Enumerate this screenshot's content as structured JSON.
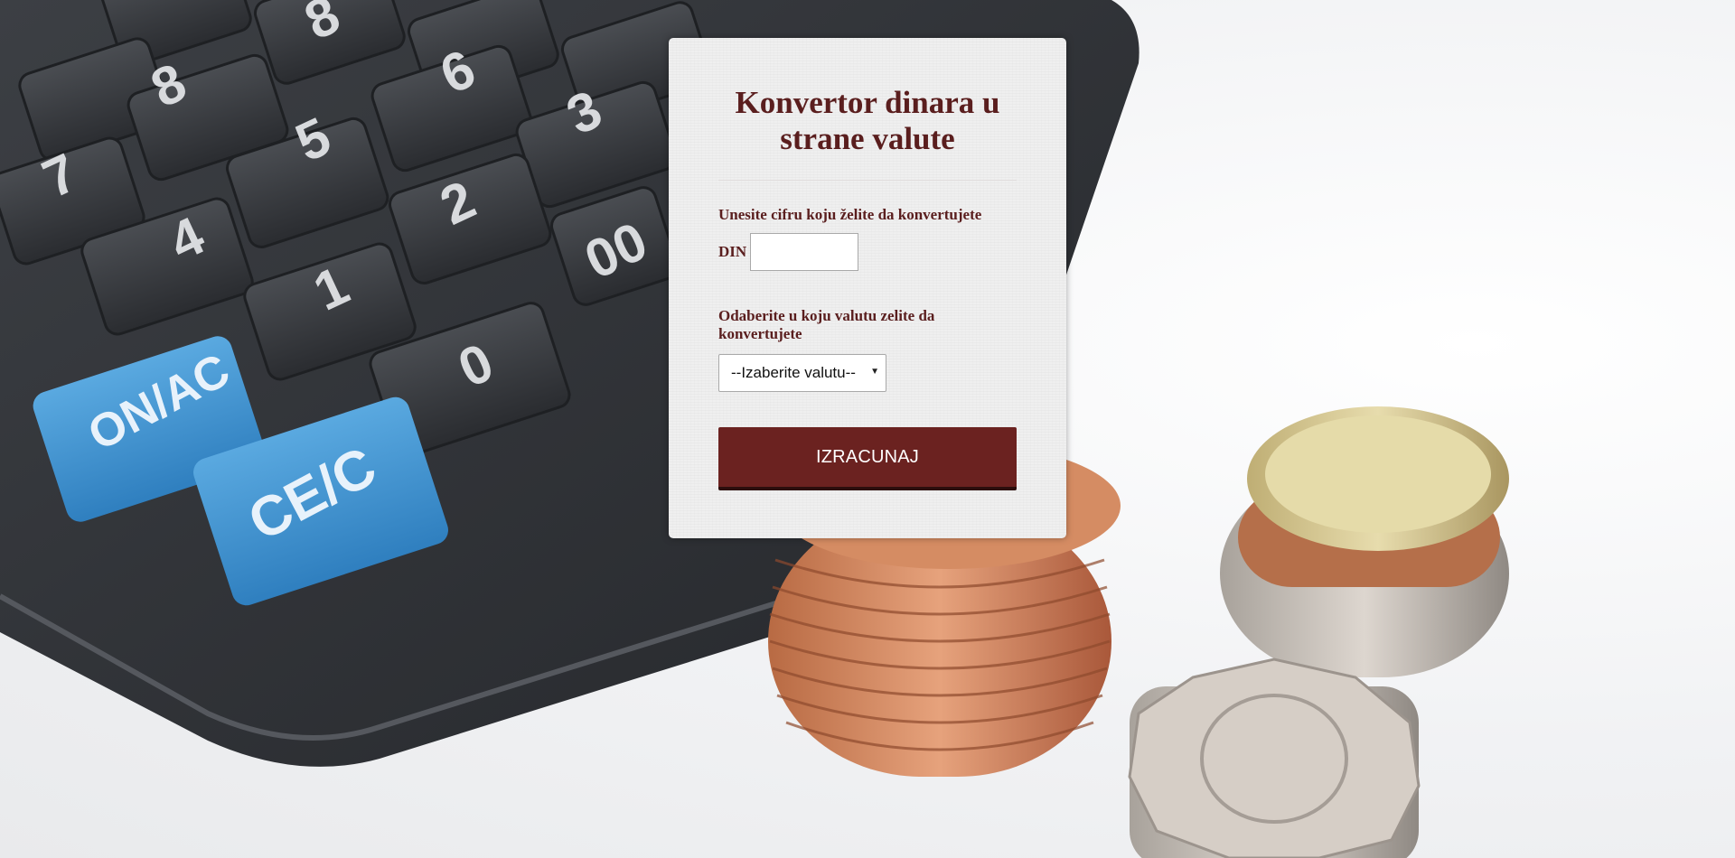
{
  "converter": {
    "title": "Konvertor dinara u strane valute",
    "amount_label": "Unesite cifru koju želite da konvertujete",
    "currency_prefix": "DIN",
    "amount_value": "",
    "currency_label": "Odaberite u koju valutu zelite da konvertujete",
    "currency_select": {
      "selected": "--Izaberite valutu--"
    },
    "submit_label": "IZRACUNAJ"
  },
  "colors": {
    "accent": "#6b2220",
    "text": "#5a1e1e",
    "card_bg": "#efefef"
  },
  "icons": {
    "select_arrow": "caret-down-icon"
  }
}
